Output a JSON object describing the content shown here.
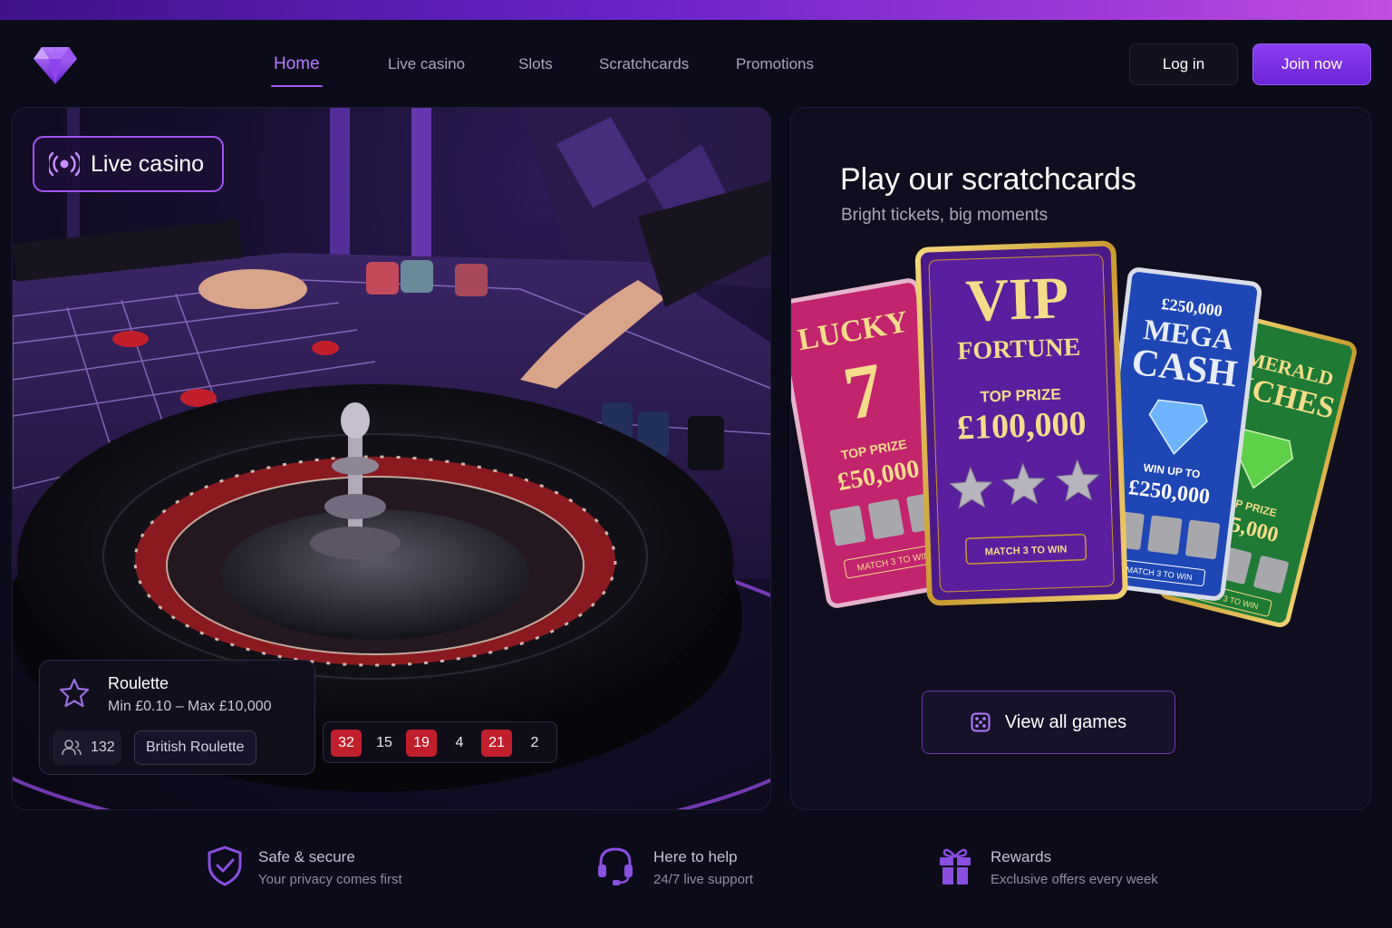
{
  "brand": {
    "logo_icon": "diamond-logo-icon",
    "accent": "#8a3ff0"
  },
  "nav": {
    "items": [
      {
        "label": "Home",
        "active": true
      },
      {
        "label": "Live casino",
        "active": false
      },
      {
        "label": "Slots",
        "active": false
      },
      {
        "label": "Scratchcards",
        "active": false
      },
      {
        "label": "Promotions",
        "active": false
      }
    ]
  },
  "auth": {
    "login_label": "Log in",
    "join_label": "Join now"
  },
  "live": {
    "badge_label": "Live casino",
    "badge_icon": "live-broadcast-icon",
    "game": {
      "title": "Roulette",
      "limits": "Min £0.10 – Max £10,000",
      "players": "132",
      "variant": "British Roulette"
    },
    "recent_results": [
      {
        "value": "32",
        "color": "red"
      },
      {
        "value": "15",
        "color": "black"
      },
      {
        "value": "19",
        "color": "red"
      },
      {
        "value": "4",
        "color": "black"
      },
      {
        "value": "21",
        "color": "red"
      },
      {
        "value": "2",
        "color": "black"
      }
    ]
  },
  "scratch": {
    "title": "Play our scratchcards",
    "subtitle": "Bright tickets, big moments",
    "cards": [
      {
        "name_line1": "LUCKY",
        "name_line2": "7",
        "prize_label": "TOP PRIZE",
        "prize": "£50,000",
        "footer": "MATCH 3 TO WIN",
        "color": "#c2246e"
      },
      {
        "name_line1": "VIP",
        "name_line2": "FORTUNE",
        "prize_label": "TOP PRIZE",
        "prize": "£100,000",
        "footer": "MATCH 3 TO WIN",
        "color": "#5a1f9e"
      },
      {
        "name_line1": "£250,000",
        "name_line2": "MEGA",
        "name_line3": "CASH",
        "prize_label": "WIN UP TO",
        "prize": "£250,000",
        "footer": "MATCH 3 TO WIN",
        "color": "#1f46b5"
      },
      {
        "name_line1": "EMERALD",
        "name_line2": "RICHES",
        "prize_label": "TOP PRIZE",
        "prize": "£75,000",
        "footer": "MATCH 3 TO WIN",
        "color": "#1e7a35"
      }
    ],
    "view_all_label": "View all games"
  },
  "features": [
    {
      "title": "Safe & secure",
      "subtitle": "Your privacy comes first",
      "icon": "shield-check-icon"
    },
    {
      "title": "Here to help",
      "subtitle": "24/7 live support",
      "icon": "headset-icon"
    },
    {
      "title": "Rewards",
      "subtitle": "Exclusive offers every week",
      "icon": "gift-icon"
    }
  ]
}
